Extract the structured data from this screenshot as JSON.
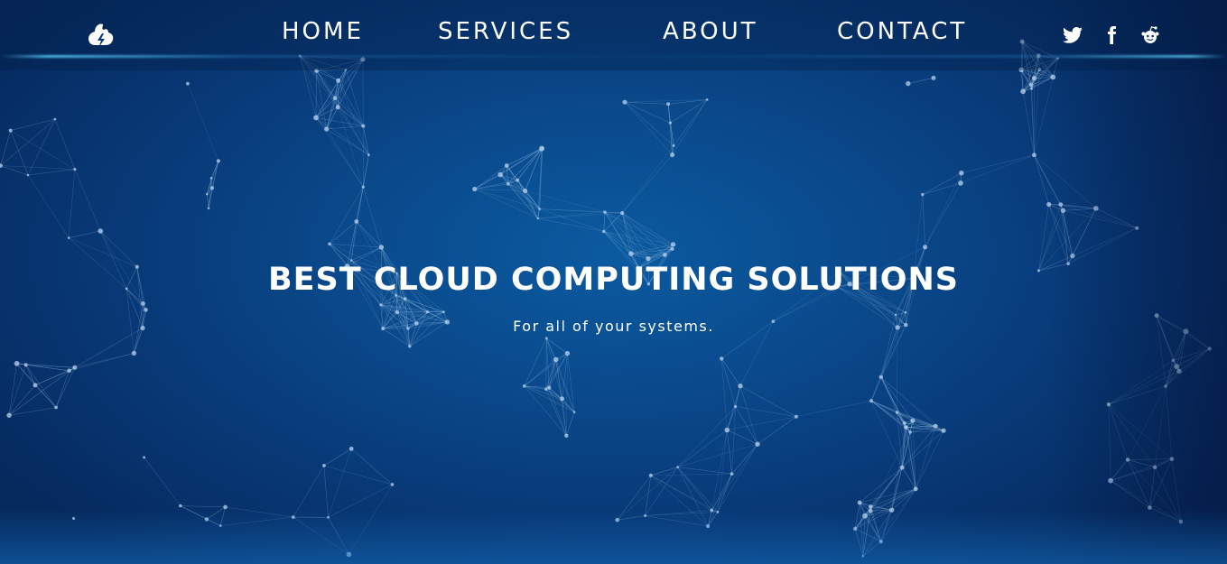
{
  "header": {
    "logo_icon": "cloud-lightning-icon",
    "nav": [
      {
        "label": "HOME"
      },
      {
        "label": "SERVICES"
      },
      {
        "label": "ABOUT"
      },
      {
        "label": "CONTACT"
      }
    ],
    "social": [
      {
        "icon": "twitter-icon"
      },
      {
        "icon": "facebook-icon"
      },
      {
        "icon": "reddit-icon"
      }
    ]
  },
  "hero": {
    "title": "BEST CLOUD COMPUTING SOLUTIONS",
    "subtitle": "For all of your systems."
  },
  "colors": {
    "background": "#0a4a8c",
    "text": "#ffffff",
    "network_lines": "#8fb8e0",
    "accent_glow": "#5ad2ff"
  }
}
